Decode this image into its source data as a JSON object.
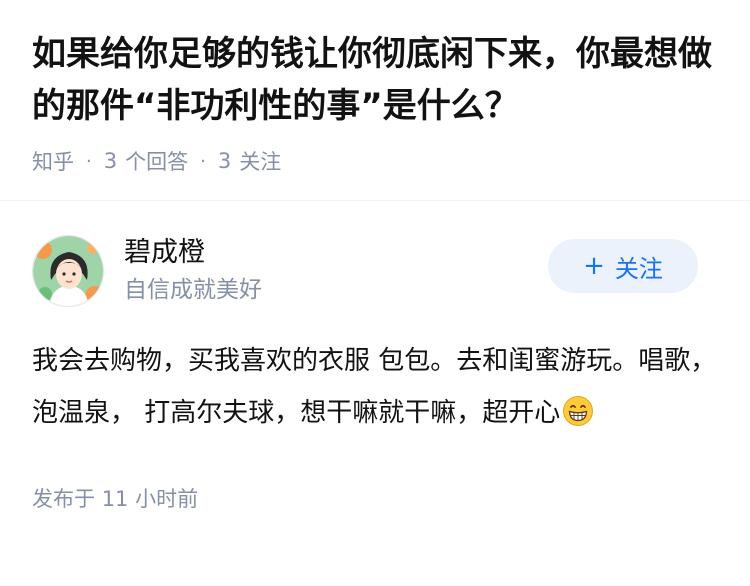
{
  "question": {
    "title": "如果给你足够的钱让你彻底闲下来，你最想做的那件“非功利性的事”是什么？",
    "source": "知乎",
    "answers_count": "3",
    "answers_label": "个回答",
    "followers_count": "3",
    "followers_label": "关注"
  },
  "answer": {
    "author_name": "碧成橙",
    "author_bio": "自信成就美好",
    "follow_label": "关注",
    "follow_icon": "plus-icon",
    "content": "我会去购物，买我喜欢的衣服 包包。去和闺蜜游玩。唱歌，泡温泉， 打高尔夫球，想干嘛就干嘛，超开心",
    "emoji": "grinning-face-emoji",
    "published_label": "发布于",
    "published_time": "11 小时前"
  },
  "colors": {
    "accent": "#1772f6",
    "follow_bg": "#ebf2fb",
    "meta_gray": "#8590a6"
  }
}
